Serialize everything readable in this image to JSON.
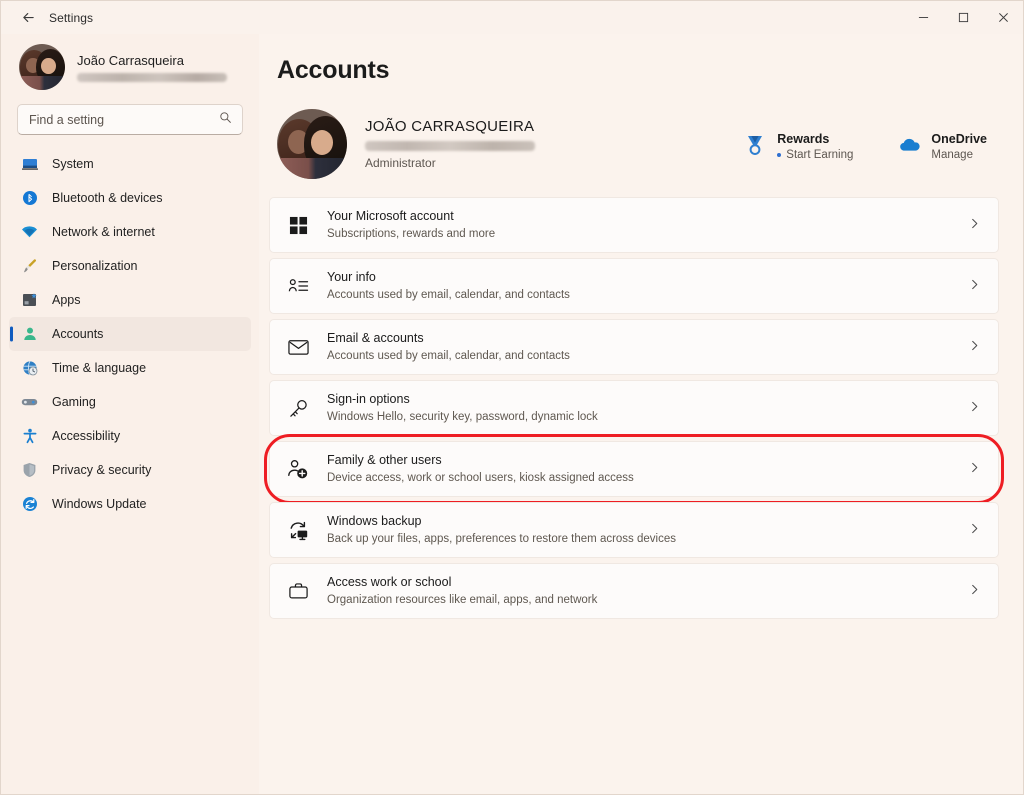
{
  "window": {
    "title": "Settings",
    "back_icon": "back-arrow-icon",
    "controls": {
      "minimize": "minimize-icon",
      "maximize": "maximize-icon",
      "close": "close-icon"
    }
  },
  "sidebar": {
    "profile": {
      "name": "João Carrasqueira",
      "email_redacted": true,
      "avatar": "user-avatar-photo"
    },
    "search": {
      "placeholder": "Find a setting",
      "value": "",
      "icon": "search-icon"
    },
    "items": [
      {
        "label": "System",
        "icon": "system-icon",
        "active": false
      },
      {
        "label": "Bluetooth & devices",
        "icon": "bluetooth-icon",
        "active": false
      },
      {
        "label": "Network & internet",
        "icon": "wifi-icon",
        "active": false
      },
      {
        "label": "Personalization",
        "icon": "paintbrush-icon",
        "active": false
      },
      {
        "label": "Apps",
        "icon": "apps-icon",
        "active": false
      },
      {
        "label": "Accounts",
        "icon": "accounts-person-icon",
        "active": true
      },
      {
        "label": "Time & language",
        "icon": "globe-clock-icon",
        "active": false
      },
      {
        "label": "Gaming",
        "icon": "gamepad-icon",
        "active": false
      },
      {
        "label": "Accessibility",
        "icon": "accessibility-person-icon",
        "active": false
      },
      {
        "label": "Privacy & security",
        "icon": "shield-icon",
        "active": false
      },
      {
        "label": "Windows Update",
        "icon": "update-refresh-icon",
        "active": false
      }
    ]
  },
  "main": {
    "page_title": "Accounts",
    "account": {
      "name": "JOÃO CARRASQUEIRA",
      "email_redacted": true,
      "role": "Administrator",
      "avatar": "user-avatar-photo"
    },
    "header_links": [
      {
        "title": "Rewards",
        "subtitle": "Start Earning",
        "icon": "rewards-medal-icon",
        "has_dot": true
      },
      {
        "title": "OneDrive",
        "subtitle": "Manage",
        "icon": "onedrive-cloud-icon",
        "has_dot": false
      }
    ],
    "cards": [
      {
        "title": "Your Microsoft account",
        "subtitle": "Subscriptions, rewards and more",
        "icon": "microsoft-logo-icon",
        "chevron": "chevron-right-icon",
        "highlighted": false
      },
      {
        "title": "Your info",
        "subtitle": "Accounts used by email, calendar, and contacts",
        "icon": "person-details-icon",
        "chevron": "chevron-right-icon",
        "highlighted": false
      },
      {
        "title": "Email & accounts",
        "subtitle": "Accounts used by email, calendar, and contacts",
        "icon": "envelope-icon",
        "chevron": "chevron-right-icon",
        "highlighted": false
      },
      {
        "title": "Sign-in options",
        "subtitle": "Windows Hello, security key, password, dynamic lock",
        "icon": "key-icon",
        "chevron": "chevron-right-icon",
        "highlighted": false
      },
      {
        "title": "Family & other users",
        "subtitle": "Device access, work or school users, kiosk assigned access",
        "icon": "person-add-icon",
        "chevron": "chevron-right-icon",
        "highlighted": true
      },
      {
        "title": "Windows backup",
        "subtitle": "Back up your files, apps, preferences to restore them across devices",
        "icon": "backup-sync-icon",
        "chevron": "chevron-right-icon",
        "highlighted": false
      },
      {
        "title": "Access work or school",
        "subtitle": "Organization resources like email, apps, and network",
        "icon": "briefcase-icon",
        "chevron": "chevron-right-icon",
        "highlighted": false
      }
    ]
  },
  "colors": {
    "window_bg": "#faf2ec",
    "sidebar_bg": "#faf0e9",
    "main_bg": "#fbf3ed",
    "card_bg": "#fdfbfa",
    "accent_blue": "#0f5bbf",
    "highlight_red": "#ee1d23",
    "accounts_icon_green": "#3ab78c"
  }
}
